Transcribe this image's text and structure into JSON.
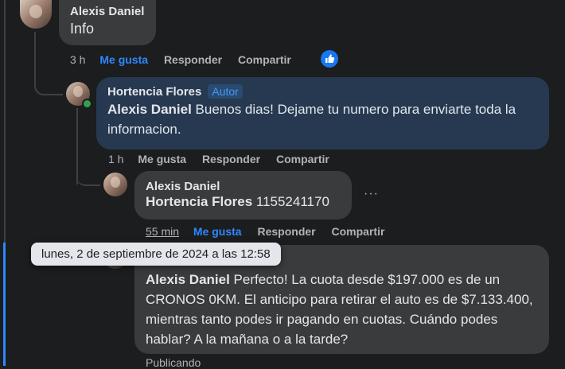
{
  "comments": [
    {
      "author": "Alexis Daniel",
      "text": "Info",
      "time": "3 h",
      "like": "Me gusta",
      "reply": "Responder",
      "share": "Compartir"
    },
    {
      "author": "Hortencia Flores",
      "badge": "Autor",
      "mention": "Alexis Daniel",
      "text": " Buenos dias! Dejame tu numero para enviarte toda la informacion.",
      "time": "1 h",
      "like": "Me gusta",
      "reply": "Responder",
      "share": "Compartir"
    },
    {
      "author": "Alexis Daniel",
      "mention": "Hortencia Flores",
      "text": " 1155241170",
      "time": "55 min",
      "like": "Me gusta",
      "reply": "Responder",
      "share": "Compartir"
    },
    {
      "mention": "Alexis Daniel",
      "text": " Perfecto! La cuota desde $197.000 es de un CRONOS 0KM. El anticipo para retirar el auto es de $7.133.400, mientras tanto podes ir pagando en cuotas. Cuándo podes hablar? A la mañana o a la tarde?",
      "status": "Publicando"
    }
  ],
  "tooltip": "lunes, 2 de septiembre de 2024 a las 12:58",
  "more_options": "···",
  "colors": {
    "background": "#1c1d1f",
    "bubble": "#3a3b3c",
    "author_bubble": "#263951",
    "accent": "#2d88ff"
  },
  "icons": {
    "like_reaction": "thumbs-up-icon",
    "more": "more-options-icon"
  }
}
